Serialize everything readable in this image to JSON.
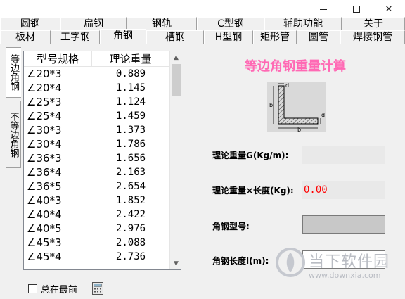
{
  "tabs_row1": [
    "圆钢",
    "扁钢",
    "钢轨",
    "C型钢",
    "辅助功能",
    "关于"
  ],
  "tabs_row2": [
    "板材",
    "工字钢",
    "角钢",
    "槽钢",
    "H型钢",
    "矩形管",
    "圆管",
    "焊接钢管"
  ],
  "vtabs": [
    "等边角钢",
    "不等边角钢"
  ],
  "list": {
    "headers": [
      "型号规格",
      "理论重量"
    ],
    "rows": [
      {
        "spec": "∠20*3",
        "weight": "0.889"
      },
      {
        "spec": "∠20*4",
        "weight": "1.145"
      },
      {
        "spec": "∠25*3",
        "weight": "1.124"
      },
      {
        "spec": "∠25*4",
        "weight": "1.459"
      },
      {
        "spec": "∠30*3",
        "weight": "1.373"
      },
      {
        "spec": "∠30*4",
        "weight": "1.786"
      },
      {
        "spec": "∠36*3",
        "weight": "1.656"
      },
      {
        "spec": "∠36*4",
        "weight": "2.163"
      },
      {
        "spec": "∠36*5",
        "weight": "2.654"
      },
      {
        "spec": "∠40*3",
        "weight": "1.852"
      },
      {
        "spec": "∠40*4",
        "weight": "2.422"
      },
      {
        "spec": "∠40*5",
        "weight": "2.976"
      },
      {
        "spec": "∠45*3",
        "weight": "2.088"
      },
      {
        "spec": "∠45*4",
        "weight": "2.736"
      }
    ]
  },
  "calc": {
    "title": "等边角钢重量计算",
    "diagram_labels": {
      "d_top": "d",
      "b_side": "b",
      "b_bottom": "b",
      "d_right": "d"
    },
    "label_g": "理论重量G(Kg/m):",
    "label_weight": "理论重量×长度(Kg):",
    "weight_value": "0.00",
    "label_type": "角钢型号:",
    "label_length": "角钢长度l(m):"
  },
  "bottom": {
    "always_on_top": "总在最前"
  },
  "watermark": {
    "text": "当下软件园",
    "url": "www.downxia.com"
  },
  "colors": {
    "title_pink": "#ff69b4",
    "value_red": "#ff0000"
  }
}
